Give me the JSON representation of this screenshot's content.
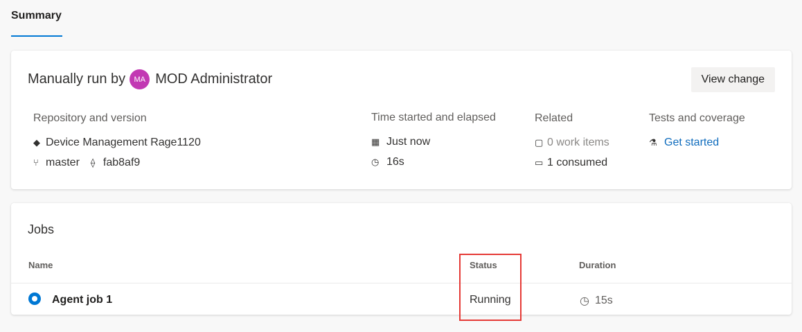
{
  "tabs": {
    "active": "Summary"
  },
  "run": {
    "prefix": "Manually run by",
    "avatar_initials": "MA",
    "user": "MOD Administrator",
    "view_change_label": "View change"
  },
  "details": {
    "repository": {
      "label": "Repository and version",
      "repo_name": "Device Management Rage1120",
      "branch": "master",
      "commit": "fab8af9"
    },
    "time": {
      "label": "Time started and elapsed",
      "started": "Just now",
      "elapsed": "16s"
    },
    "related": {
      "label": "Related",
      "work_items": "0 work items",
      "consumed": "1 consumed"
    },
    "tests": {
      "label": "Tests and coverage",
      "link": "Get started"
    }
  },
  "jobs": {
    "title": "Jobs",
    "headers": {
      "name": "Name",
      "status": "Status",
      "duration": "Duration"
    },
    "rows": [
      {
        "name": "Agent job 1",
        "status": "Running",
        "duration": "15s"
      }
    ]
  },
  "colors": {
    "accent": "#0078d4",
    "avatar": "#c239b3",
    "highlight": "#e53935"
  }
}
